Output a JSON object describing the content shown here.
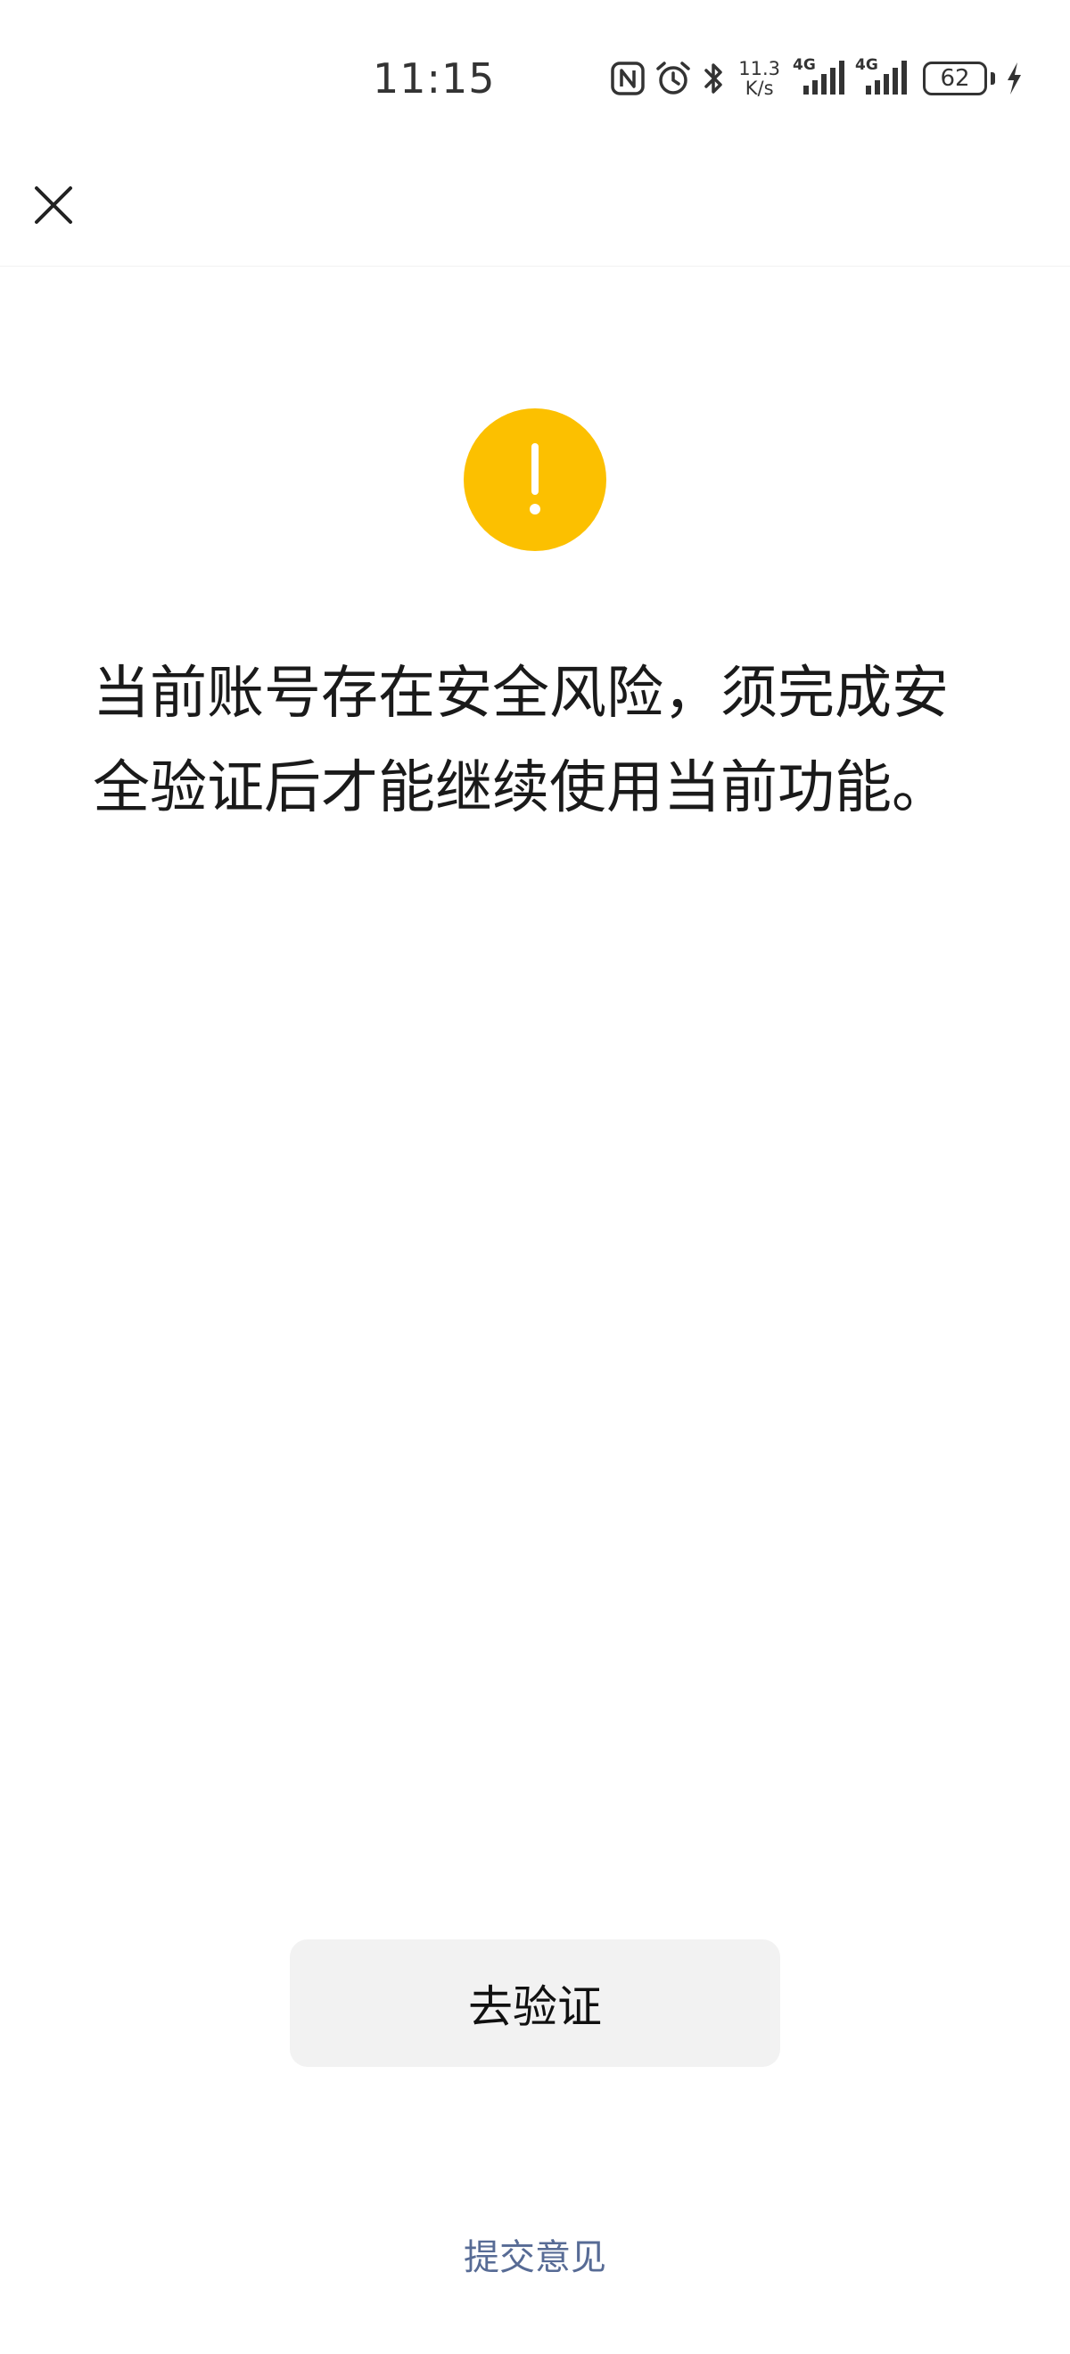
{
  "status_bar": {
    "time": "11:15",
    "net_speed_value": "11.3",
    "net_speed_unit": "K/s",
    "sim1_tag": "4G",
    "sim2_tag": "4G",
    "battery_level": "62",
    "icons": [
      "nfc-icon",
      "alarm-icon",
      "bluetooth-icon",
      "signal-icon",
      "signal-icon",
      "battery-icon",
      "charging-icon"
    ]
  },
  "nav": {
    "close_icon": "close-icon"
  },
  "alert": {
    "icon": "warning-icon",
    "icon_color": "#fcc000",
    "message": "当前账号存在安全风险，须完成安全验证后才能继续使用当前功能。"
  },
  "actions": {
    "verify_label": "去验证",
    "feedback_label": "提交意见",
    "feedback_color": "#576b95"
  }
}
